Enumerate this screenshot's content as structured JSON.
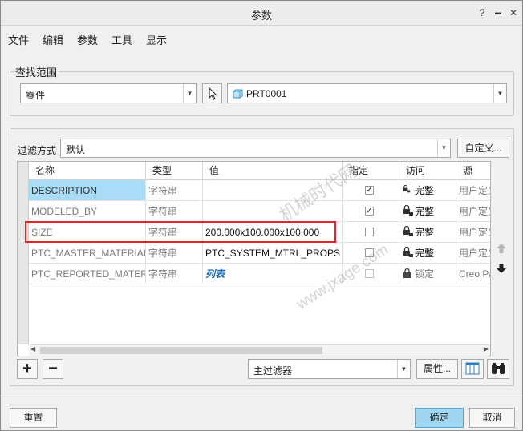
{
  "window": {
    "title": "参数"
  },
  "titlebar_buttons": {
    "help": "?",
    "minimize": "▬",
    "close": "✕"
  },
  "menu": [
    "文件",
    "编辑",
    "参数",
    "工具",
    "显示"
  ],
  "search_scope": {
    "label": "查找范围",
    "type_value": "零件",
    "object_value": "PRT0001"
  },
  "filter": {
    "label": "过滤方式",
    "value": "默认",
    "custom_button": "自定义..."
  },
  "table": {
    "headers": [
      "名称",
      "类型",
      "值",
      "指定",
      "访问",
      "源"
    ],
    "rows": [
      {
        "name": "DESCRIPTION",
        "type": "字符串",
        "value": "",
        "designate": true,
        "access": "完整",
        "source": "用户定义"
      },
      {
        "name": "MODELED_BY",
        "type": "字符串",
        "value": "",
        "designate": true,
        "access": "完整",
        "source": "用户定义"
      },
      {
        "name": "SIZE",
        "type": "字符串",
        "value": "200.000x100.000x100.000",
        "designate": false,
        "access": "完整",
        "source": "用户定义"
      },
      {
        "name": "PTC_MASTER_MATERIAL",
        "type": "字符串",
        "value": "PTC_SYSTEM_MTRL_PROPS",
        "designate": false,
        "access": "完整",
        "source": "用户定义"
      },
      {
        "name": "PTC_REPORTED_MATERIAL",
        "type": "字符串",
        "value": "列表",
        "designate": false,
        "access": "锁定",
        "source": "Creo Parametric"
      }
    ]
  },
  "bottom_toolbar": {
    "add": "+",
    "remove": "−",
    "main_filter": "主过滤器",
    "properties": "属性..."
  },
  "footer": {
    "reset": "重置",
    "ok": "确定",
    "cancel": "取消"
  },
  "watermark": {
    "line1": "机械时代网",
    "line2": "www.jxage.com"
  },
  "colors": {
    "selection": "#a9dcf6",
    "highlight_box": "#e0242a",
    "primary_button": "#9fd7f2"
  }
}
